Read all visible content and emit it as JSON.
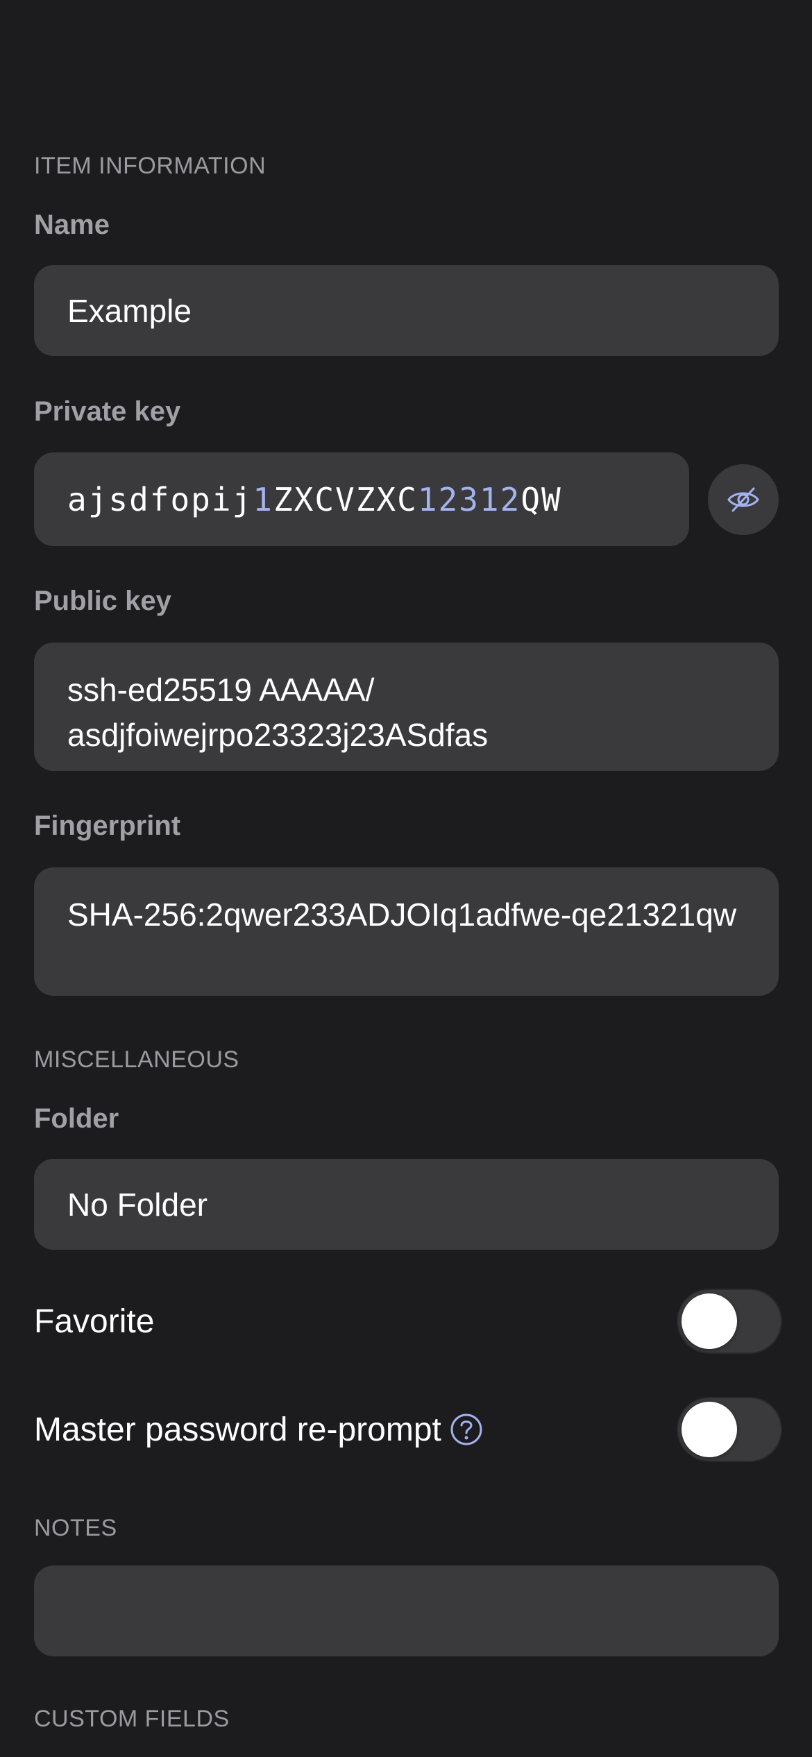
{
  "sections": {
    "item_information": "ITEM INFORMATION",
    "miscellaneous": "MISCELLANEOUS",
    "notes": "NOTES",
    "custom_fields": "CUSTOM FIELDS"
  },
  "name": {
    "label": "Name",
    "value": "Example"
  },
  "private_key": {
    "label": "Private key",
    "segments": [
      "ajsdfopij",
      "1",
      "ZXCVZXC",
      "12312",
      "QW"
    ],
    "toggle_visibility_icon": "eye-slash-icon"
  },
  "public_key": {
    "label": "Public key",
    "value": "ssh-ed25519 AAAAA/ asdjfoiwejrpo23323j23ASdfas"
  },
  "fingerprint": {
    "label": "Fingerprint",
    "value": "SHA-256:2qwer233ADJOIq1adfwe-qe21321qw"
  },
  "folder": {
    "label": "Folder",
    "value": "No Folder"
  },
  "favorite": {
    "label": "Favorite",
    "enabled": false
  },
  "master_password_reprompt": {
    "label": "Master password re-prompt",
    "enabled": false,
    "help_icon": "question-circle-icon"
  },
  "notes": {
    "value": ""
  },
  "colors": {
    "background": "#1c1c1e",
    "field": "#3a3a3c",
    "accent": "#a4b2ee",
    "label": "#a0a0a6"
  }
}
